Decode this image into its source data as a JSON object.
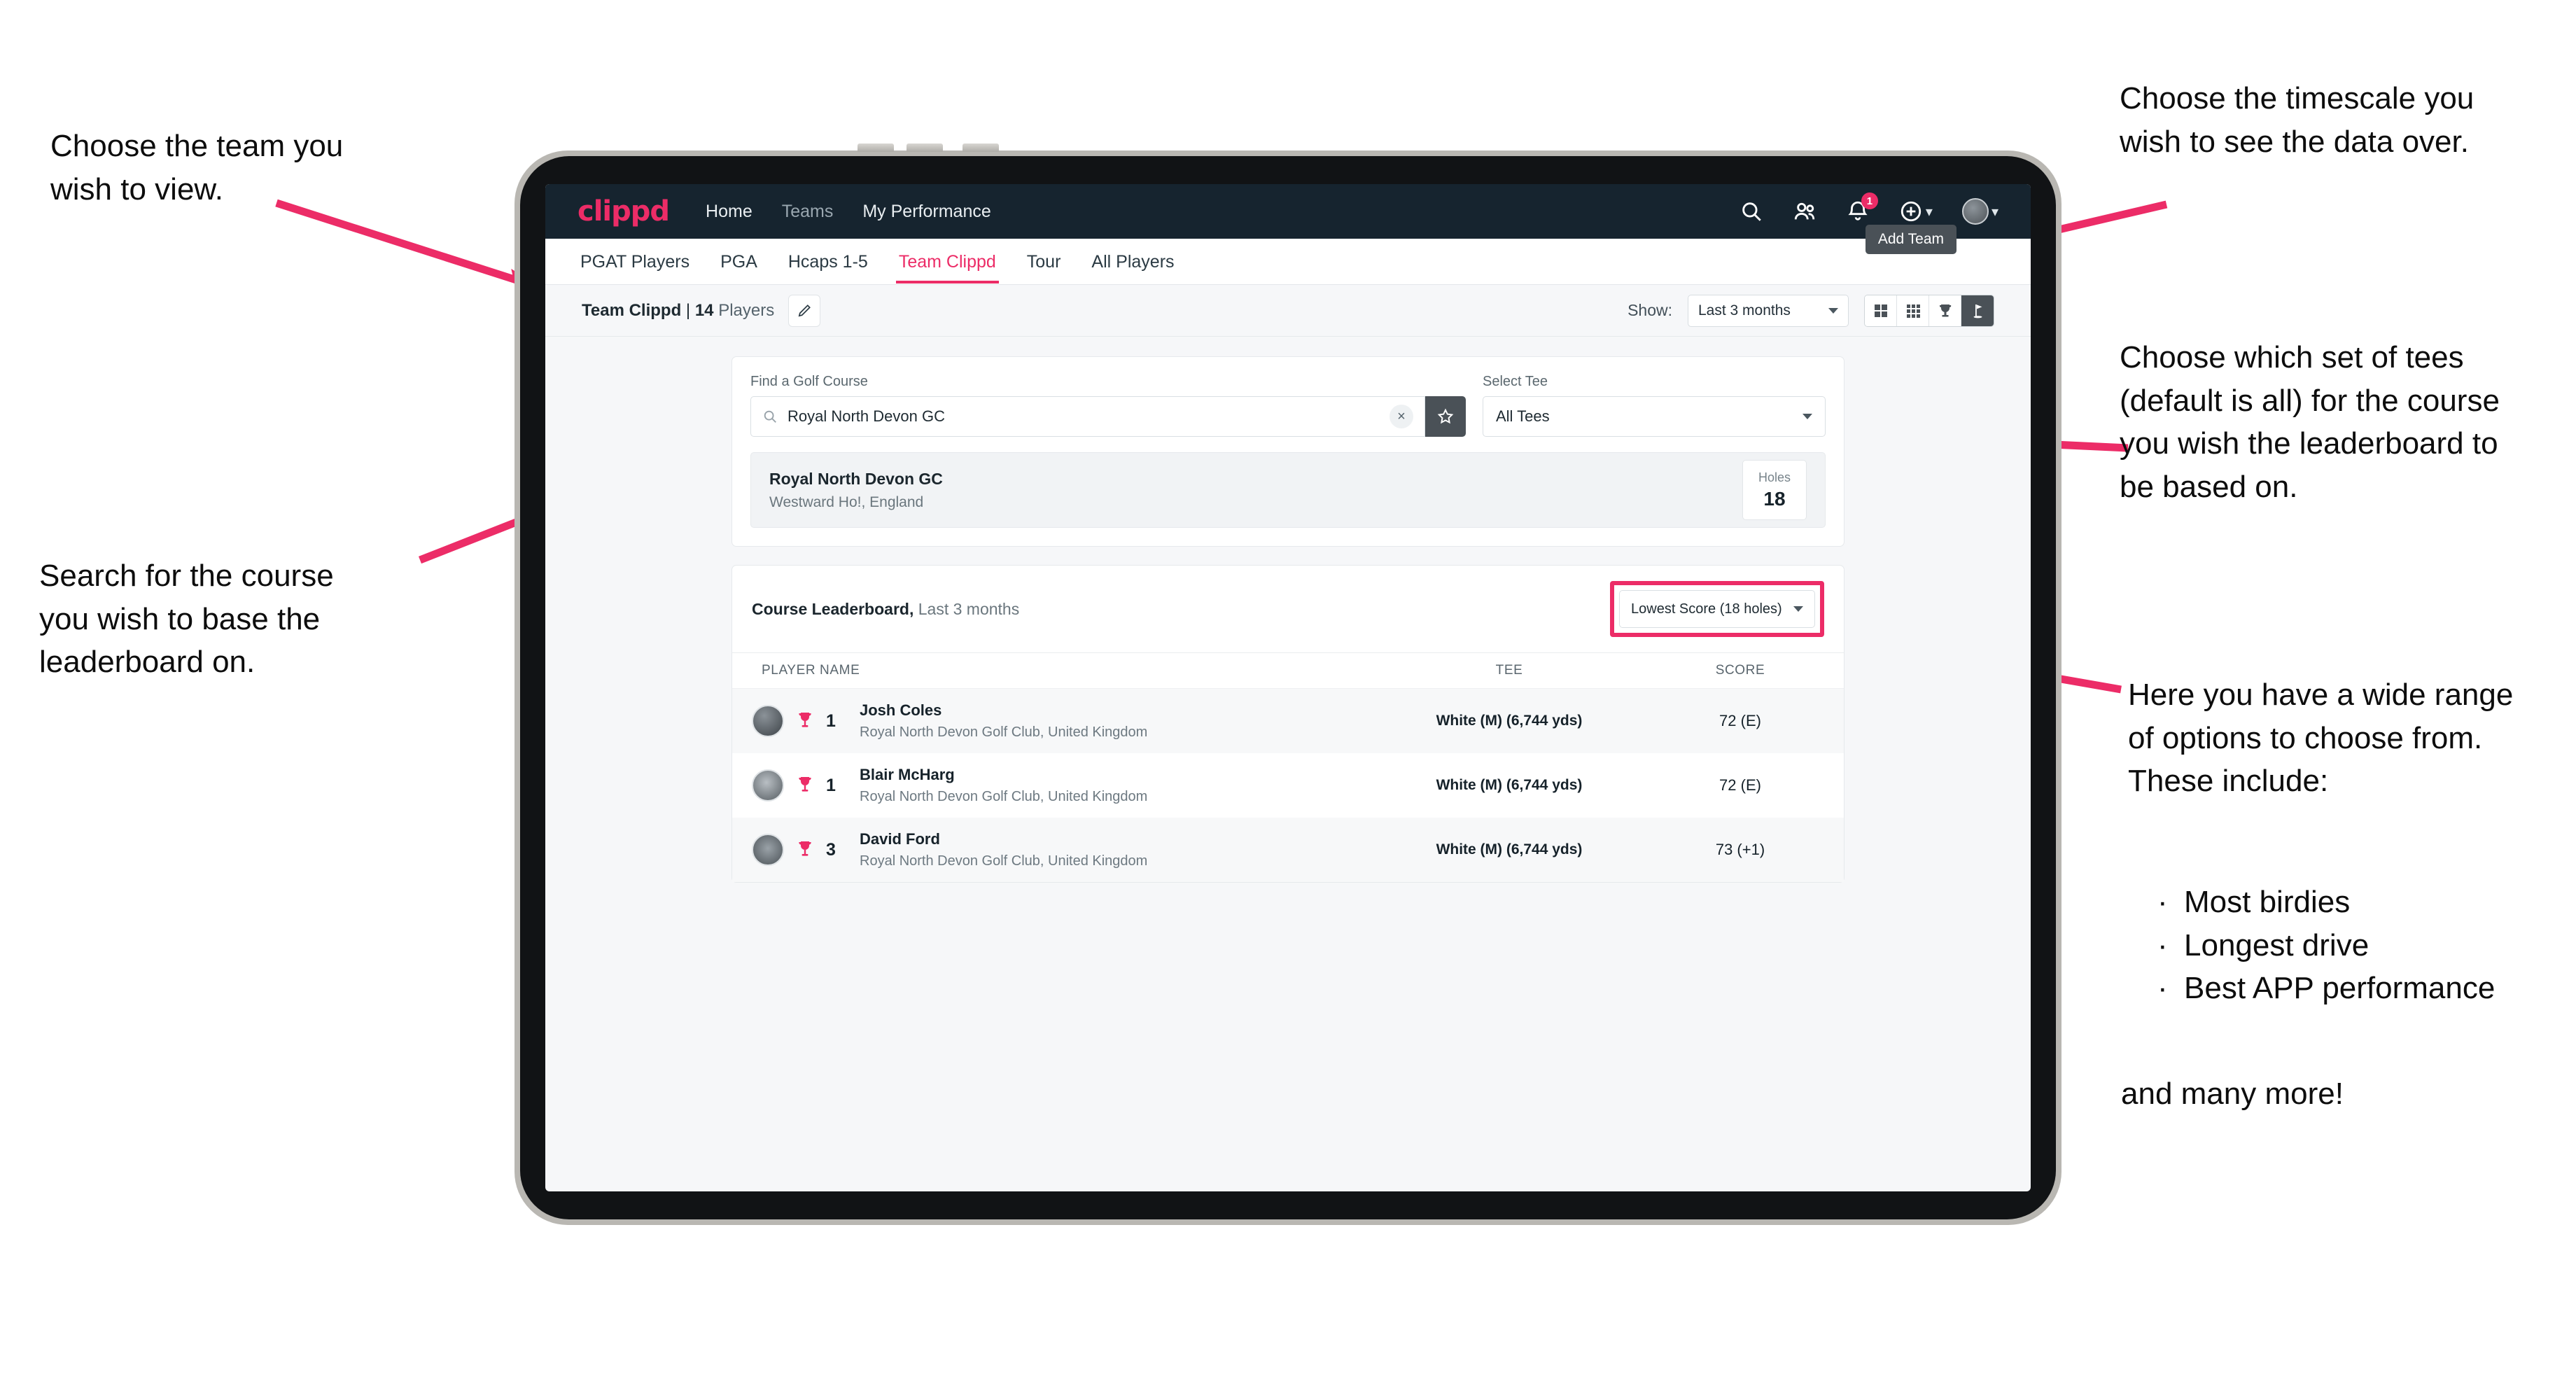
{
  "annotations": {
    "team": "Choose the team you\nwish to view.",
    "timescale": "Choose the timescale you\nwish to see the data over.",
    "tees": "Choose which set of tees\n(default is all) for the course\nyou wish the leaderboard to\nbe based on.",
    "search": "Search for the course\nyou wish to base the\nleaderboard on.",
    "options_intro": "Here you have a wide range\nof options to choose from.\nThese include:",
    "options_list": [
      "Most birdies",
      "Longest drive",
      "Best APP performance"
    ],
    "options_outro": "and many more!"
  },
  "app": {
    "brand": "clippd",
    "nav_links": [
      {
        "label": "Home",
        "active": true
      },
      {
        "label": "Teams",
        "active": false
      },
      {
        "label": "My Performance",
        "active": true
      }
    ],
    "notification_count": "1",
    "tooltip": "Add Team",
    "tabs": [
      {
        "label": "PGAT Players",
        "state": "normal"
      },
      {
        "label": "PGA",
        "state": "normal"
      },
      {
        "label": "Hcaps 1-5",
        "state": "normal"
      },
      {
        "label": "Team Clippd",
        "state": "active"
      },
      {
        "label": "Tour",
        "state": "normal"
      },
      {
        "label": "All Players",
        "state": "normal"
      }
    ],
    "subbar": {
      "team_name": "Team Clippd",
      "separator": " | ",
      "player_count": "14",
      "players_word": "Players",
      "show_label": "Show:",
      "timescale_value": "Last 3 months",
      "view_icons": [
        "grid-large-icon",
        "grid-small-icon",
        "trophy-icon",
        "golf-flag-icon"
      ]
    },
    "search_panel": {
      "course_label": "Find a Golf Course",
      "course_value": "Royal North Devon GC",
      "course_placeholder": "Find a Golf Course",
      "clear_glyph": "×",
      "tee_label": "Select Tee",
      "tee_value": "All Tees"
    },
    "course_result": {
      "name": "Royal North Devon GC",
      "location": "Westward Ho!, England",
      "holes_label": "Holes",
      "holes_value": "18"
    },
    "leaderboard": {
      "title": "Course Leaderboard,",
      "subtitle": " Last 3 months",
      "sort_value": "Lowest Score (18 holes)",
      "columns": [
        "PLAYER NAME",
        "TEE",
        "SCORE"
      ],
      "rows": [
        {
          "rank": "1",
          "name": "Josh Coles",
          "club": "Royal North Devon Golf Club, United Kingdom",
          "tee": "White (M) (6,744 yds)",
          "score": "72 (E)"
        },
        {
          "rank": "1",
          "name": "Blair McHarg",
          "club": "Royal North Devon Golf Club, United Kingdom",
          "tee": "White (M) (6,744 yds)",
          "score": "72 (E)"
        },
        {
          "rank": "3",
          "name": "David Ford",
          "club": "Royal North Devon Golf Club, United Kingdom",
          "tee": "White (M) (6,744 yds)",
          "score": "73 (+1)"
        }
      ]
    }
  },
  "colors": {
    "accent": "#ec2c67",
    "navbar": "#16242f",
    "dark_control": "#4a5157",
    "page_bg": "#f6f7f9"
  }
}
